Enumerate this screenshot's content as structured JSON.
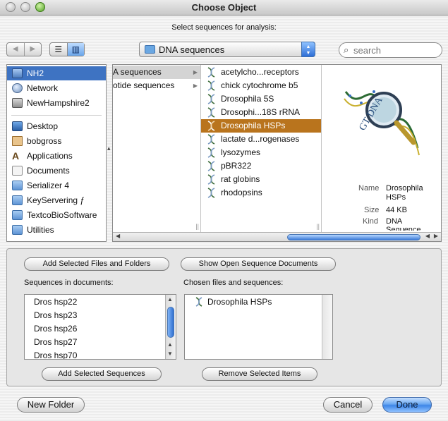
{
  "window": {
    "title": "Choose Object"
  },
  "prompt": "Select sequences for analysis:",
  "toolbar": {
    "back_glyph": "◀",
    "forward_glyph": "▶",
    "location": "DNA sequences",
    "search_placeholder": "search"
  },
  "sidebar": {
    "devices": [
      {
        "label": "NH2",
        "icon": "computer-icon",
        "selected": true
      },
      {
        "label": "Network",
        "icon": "network-globe-icon"
      },
      {
        "label": "NewHampshire2",
        "icon": "hard-disk-icon"
      }
    ],
    "places": [
      {
        "label": "Desktop",
        "icon": "desktop-icon"
      },
      {
        "label": "bobgross",
        "icon": "home-icon"
      },
      {
        "label": "Applications",
        "icon": "applications-icon"
      },
      {
        "label": "Documents",
        "icon": "documents-icon"
      },
      {
        "label": "Serializer 4",
        "icon": "folder-icon"
      },
      {
        "label": "KeyServering ƒ",
        "icon": "folder-icon"
      },
      {
        "label": "TextcoBioSoftware",
        "icon": "folder-icon"
      },
      {
        "label": "Utilities",
        "icon": "folder-icon"
      }
    ]
  },
  "browser": {
    "column1": [
      {
        "label": "A sequences",
        "has_children": true,
        "highlighted": true
      },
      {
        "label": "otide sequences",
        "has_children": true
      }
    ],
    "column2": [
      {
        "label": "acetylcho...receptors"
      },
      {
        "label": "chick cytochrome b5"
      },
      {
        "label": "Drosophila 5S"
      },
      {
        "label": "Drosophi...18S rRNA"
      },
      {
        "label": "Drosophila HSPs",
        "selected": true
      },
      {
        "label": "lactate d...rogenases"
      },
      {
        "label": "lysozymes"
      },
      {
        "label": "pBR322"
      },
      {
        "label": "rat globins"
      },
      {
        "label": "rhodopsins"
      }
    ],
    "preview": {
      "logo_text": "GT DNA",
      "name_label": "Name",
      "name_value_line1": "Drosophila",
      "name_value_line2": "HSPs",
      "size_label": "Size",
      "size_value": "44 KB",
      "kind_label": "Kind",
      "kind_value": "DNA",
      "kind_value_cut": "Sequence"
    }
  },
  "lower": {
    "add_files_button": "Add Selected Files and Folders",
    "show_open_button": "Show Open Sequence Documents",
    "sequences_label": "Sequences in documents:",
    "sequences": [
      "Dros hsp22",
      "Dros hsp23",
      "Dros hsp26",
      "Dros hsp27",
      "Dros hsp70"
    ],
    "chosen_label": "Chosen files and sequences:",
    "chosen": [
      "Drosophila HSPs"
    ],
    "add_sequences_button": "Add Selected Sequences",
    "remove_button": "Remove Selected Items"
  },
  "footer": {
    "new_folder": "New Folder",
    "cancel": "Cancel",
    "done": "Done"
  }
}
